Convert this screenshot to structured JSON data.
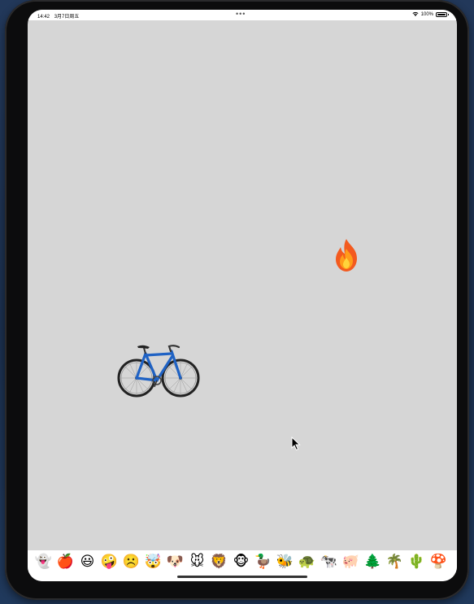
{
  "status_bar": {
    "time": "14:42",
    "date": "3月7日周五",
    "center_dots": "•••",
    "battery": "100%",
    "battery_level": 1.0
  },
  "canvas": {
    "stickers": [
      {
        "name": "fire",
        "emoji": "🔥"
      },
      {
        "name": "bicycle",
        "emoji": "🚲"
      }
    ]
  },
  "emoji_tray": {
    "items": [
      {
        "name": "ghost",
        "emoji": "👻"
      },
      {
        "name": "apple",
        "emoji": "🍎"
      },
      {
        "name": "smiley",
        "emoji": "😃"
      },
      {
        "name": "zany-face",
        "emoji": "🤪"
      },
      {
        "name": "frowning-face",
        "emoji": "☹️"
      },
      {
        "name": "exploding-head",
        "emoji": "🤯"
      },
      {
        "name": "dog",
        "emoji": "🐶"
      },
      {
        "name": "mouse",
        "emoji": "🐭"
      },
      {
        "name": "lion",
        "emoji": "🦁"
      },
      {
        "name": "monkey",
        "emoji": "🐵"
      },
      {
        "name": "duck",
        "emoji": "🦆"
      },
      {
        "name": "bee",
        "emoji": "🐝"
      },
      {
        "name": "turtle",
        "emoji": "🐢"
      },
      {
        "name": "cow",
        "emoji": "🐄"
      },
      {
        "name": "pig",
        "emoji": "🐖"
      },
      {
        "name": "evergreen-tree",
        "emoji": "🌲"
      },
      {
        "name": "palm-tree",
        "emoji": "🌴"
      },
      {
        "name": "cactus",
        "emoji": "🌵"
      },
      {
        "name": "mushroom",
        "emoji": "🍄"
      }
    ]
  }
}
